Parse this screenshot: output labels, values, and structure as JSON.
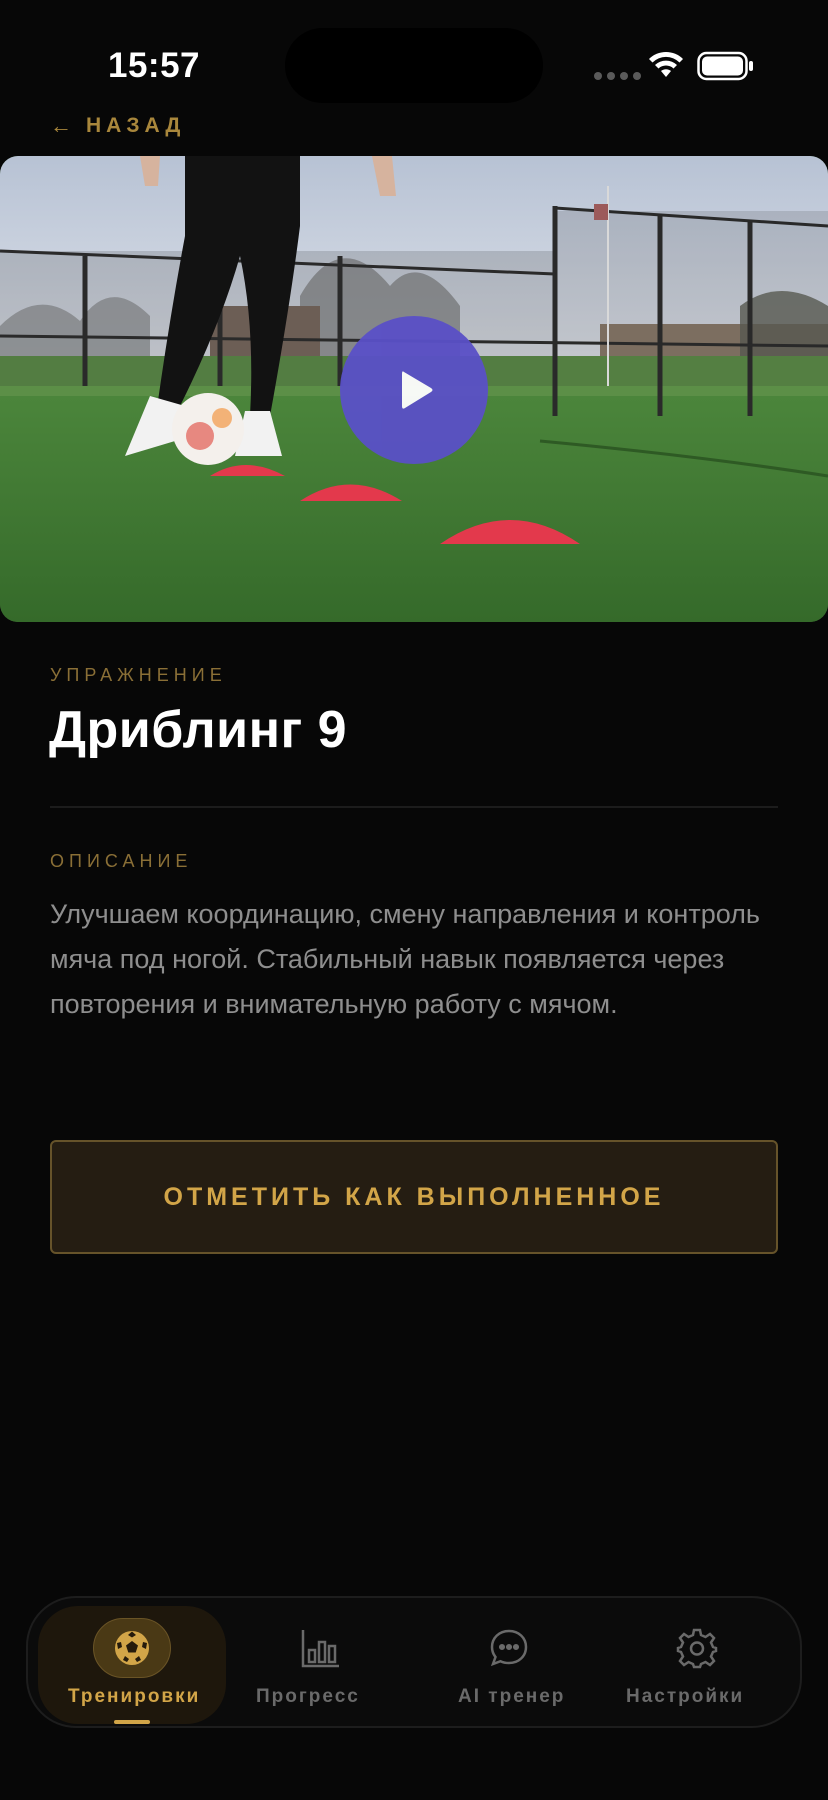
{
  "status": {
    "time": "15:57"
  },
  "nav": {
    "back_label": "НАЗАД",
    "back_arrow": "←"
  },
  "exercise": {
    "section_label": "УПРАЖНЕНИЕ",
    "title": "Дриблинг 9",
    "description_label": "ОПИСАНИЕ",
    "description": "Улучшаем координацию, смену направления и контроль мяча под ногой. Стабильный навык появляется через повторения и внимательную работу с мячом.",
    "mark_done_label": "ОТМЕТИТЬ КАК ВЫПОЛНЕННОЕ"
  },
  "tabbar": {
    "items": [
      {
        "label": "Тренировки",
        "icon": "soccer-ball-icon",
        "active": true
      },
      {
        "label": "Прогресс",
        "icon": "bar-chart-icon",
        "active": false
      },
      {
        "label": "AI тренер",
        "icon": "chat-bubble-icon",
        "active": false
      },
      {
        "label": "Настройки",
        "icon": "gear-icon",
        "active": false
      }
    ]
  },
  "colors": {
    "accent": "#d2a548",
    "background": "#070707",
    "play_button": "#5a50c7"
  }
}
